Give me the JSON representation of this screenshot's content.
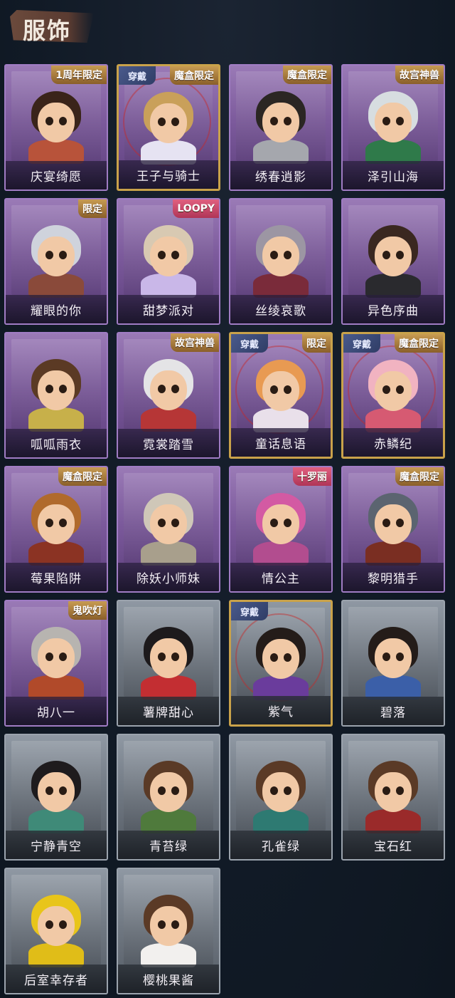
{
  "header": {
    "title": "服饰"
  },
  "cards": [
    {
      "name": "庆宴绮愿",
      "theme": "purple",
      "badge": "1周年限定",
      "badge_style": "gold",
      "equipped": false,
      "hair": "#3a241a",
      "outfit": "#b8533a"
    },
    {
      "name": "王子与骑士",
      "theme": "purple",
      "badge": "魔盒限定",
      "badge_style": "gold",
      "equipped": true,
      "hair": "#c9a05a",
      "outfit": "#e6e3f2"
    },
    {
      "name": "绣春逍影",
      "theme": "purple",
      "badge": "魔盒限定",
      "badge_style": "gold",
      "equipped": false,
      "hair": "#2b2623",
      "outfit": "#a5a7ad"
    },
    {
      "name": "泽引山海",
      "theme": "purple",
      "badge": "故宫神兽",
      "badge_style": "gold",
      "equipped": false,
      "hair": "#d7dde0",
      "outfit": "#2f7a4a"
    },
    {
      "name": "耀眼的你",
      "theme": "purple",
      "badge": "限定",
      "badge_style": "gold",
      "equipped": false,
      "hair": "#cfd3dc",
      "outfit": "#8a4a3a"
    },
    {
      "name": "甜梦派对",
      "theme": "purple",
      "badge": "LOOPY",
      "badge_style": "pink",
      "equipped": false,
      "hair": "#d8c9b2",
      "outfit": "#c9b7e8"
    },
    {
      "name": "丝绫哀歌",
      "theme": "purple",
      "badge": "",
      "badge_style": "gold",
      "equipped": false,
      "hair": "#9c96a3",
      "outfit": "#7a2b3a"
    },
    {
      "name": "异色序曲",
      "theme": "purple",
      "badge": "",
      "badge_style": "gold",
      "equipped": false,
      "hair": "#3a2820",
      "outfit": "#2a2a2e"
    },
    {
      "name": "呱呱雨衣",
      "theme": "purple",
      "badge": "",
      "badge_style": "gold",
      "equipped": false,
      "hair": "#5b3a24",
      "outfit": "#c7b04a"
    },
    {
      "name": "霓裳踏雪",
      "theme": "purple",
      "badge": "故宫神兽",
      "badge_style": "gold",
      "equipped": false,
      "hair": "#e4e4e6",
      "outfit": "#b63636"
    },
    {
      "name": "童话息语",
      "theme": "purple",
      "badge": "限定",
      "badge_style": "gold",
      "equipped": true,
      "hair": "#e89a52",
      "outfit": "#e9e0ea"
    },
    {
      "name": "赤鳞纪",
      "theme": "purple",
      "badge": "魔盒限定",
      "badge_style": "gold",
      "equipped": true,
      "hair": "#f1b3c1",
      "outfit": "#d65a72"
    },
    {
      "name": "莓果陷阱",
      "theme": "purple",
      "badge": "魔盒限定",
      "badge_style": "gold",
      "equipped": false,
      "hair": "#b06a2c",
      "outfit": "#8b3323"
    },
    {
      "name": "除妖小师妹",
      "theme": "purple",
      "badge": "",
      "badge_style": "gold",
      "equipped": false,
      "hair": "#cfc7b8",
      "outfit": "#a89f8c"
    },
    {
      "name": "情公主",
      "theme": "purple",
      "badge": "十罗丽",
      "badge_style": "pink",
      "equipped": false,
      "hair": "#d35aa3",
      "outfit": "#b24d8f"
    },
    {
      "name": "黎明猎手",
      "theme": "purple",
      "badge": "魔盒限定",
      "badge_style": "gold",
      "equipped": false,
      "hair": "#5b6470",
      "outfit": "#7a2e22"
    },
    {
      "name": "胡八一",
      "theme": "purple",
      "badge": "鬼吹灯",
      "badge_style": "gold",
      "equipped": false,
      "hair": "#b7b4b0",
      "outfit": "#b14a2a"
    },
    {
      "name": "薯牌甜心",
      "theme": "gray",
      "badge": "",
      "badge_style": "gold",
      "equipped": false,
      "hair": "#1d1a1c",
      "outfit": "#c32e32"
    },
    {
      "name": "紫气",
      "theme": "gray",
      "badge": "",
      "badge_style": "gold",
      "equipped": true,
      "hair": "#241c19",
      "outfit": "#6a3c9c"
    },
    {
      "name": "碧落",
      "theme": "gray",
      "badge": "",
      "badge_style": "gold",
      "equipped": false,
      "hair": "#241c19",
      "outfit": "#3b5fa8"
    },
    {
      "name": "宁静青空",
      "theme": "gray",
      "badge": "",
      "badge_style": "gold",
      "equipped": false,
      "hair": "#1e1b1d",
      "outfit": "#3f8a78"
    },
    {
      "name": "青苔绿",
      "theme": "gray",
      "badge": "",
      "badge_style": "gold",
      "equipped": false,
      "hair": "#5a3a26",
      "outfit": "#4f7a3c"
    },
    {
      "name": "孔雀绿",
      "theme": "gray",
      "badge": "",
      "badge_style": "gold",
      "equipped": false,
      "hair": "#5a3a26",
      "outfit": "#2e7a72"
    },
    {
      "name": "宝石红",
      "theme": "gray",
      "badge": "",
      "badge_style": "gold",
      "equipped": false,
      "hair": "#5a3a26",
      "outfit": "#9a2a2a"
    },
    {
      "name": "后室幸存者",
      "theme": "gray",
      "badge": "",
      "badge_style": "gold",
      "equipped": false,
      "hair": "#e8c51a",
      "outfit": "#e0bd18"
    },
    {
      "name": "樱桃果酱",
      "theme": "gray",
      "badge": "",
      "badge_style": "gold",
      "equipped": false,
      "hair": "#5b3a26",
      "outfit": "#f2f0ee"
    }
  ],
  "labels": {
    "equipped_tag": "穿戴"
  }
}
